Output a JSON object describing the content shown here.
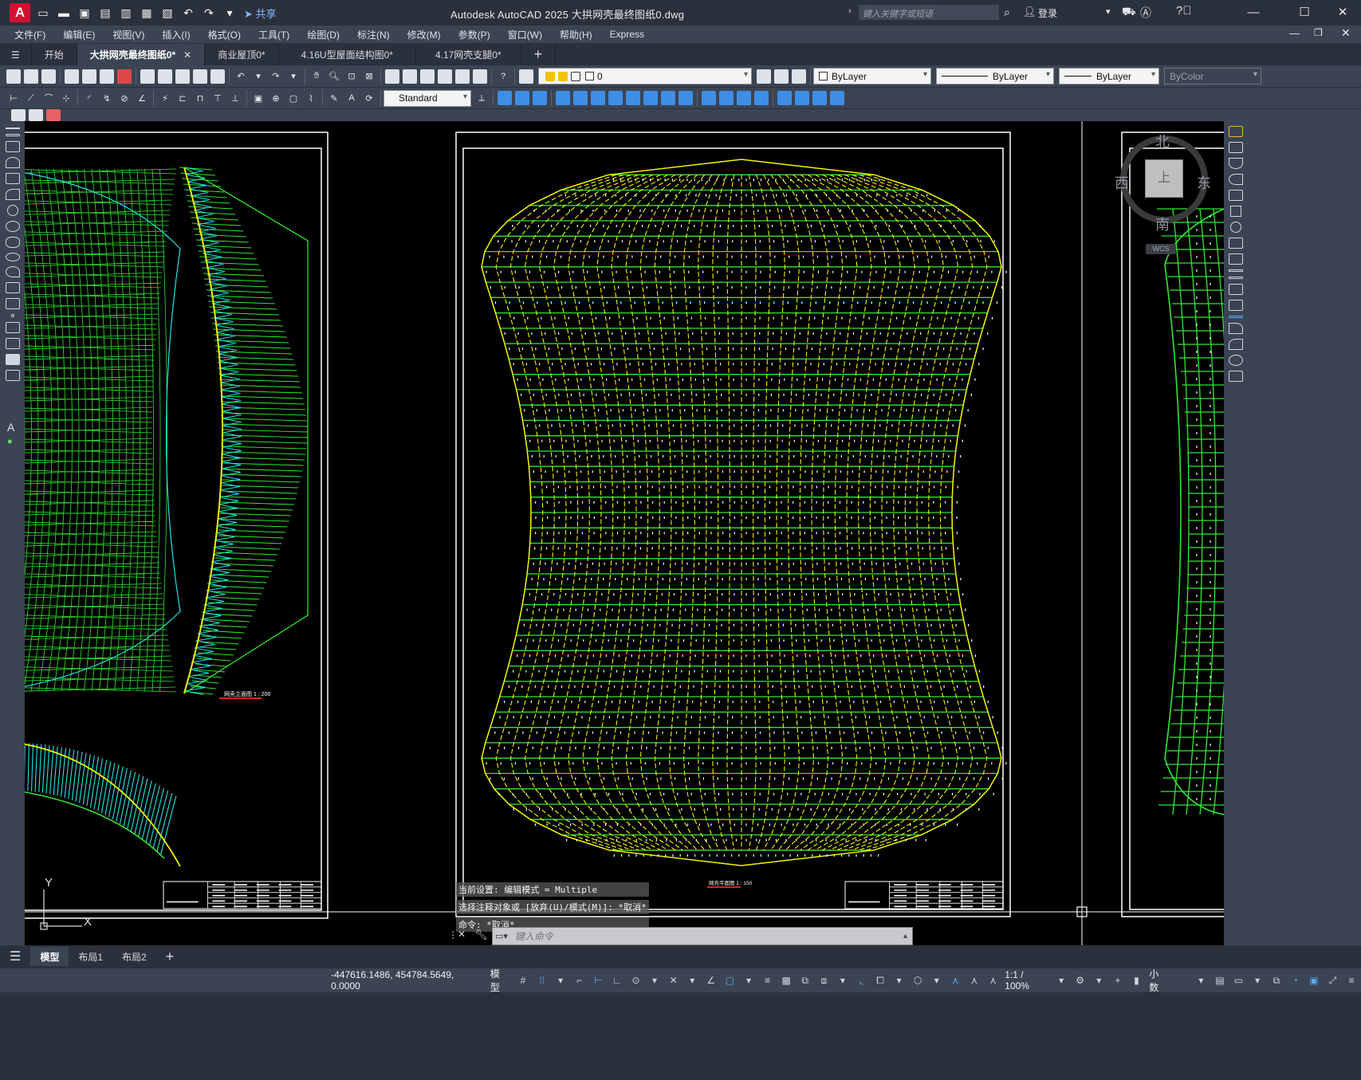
{
  "titlebar": {
    "app_letter": "A",
    "share": "共享",
    "title": "Autodesk AutoCAD 2025    大拱网壳最终图纸0.dwg",
    "search_placeholder": "键入关键字或短语",
    "login": "登录"
  },
  "menu": [
    "文件(F)",
    "编辑(E)",
    "视图(V)",
    "插入(I)",
    "格式(O)",
    "工具(T)",
    "绘图(D)",
    "标注(N)",
    "修改(M)",
    "参数(P)",
    "窗口(W)",
    "帮助(H)",
    "Express"
  ],
  "tabs": {
    "start": "开始",
    "items": [
      "大拱网壳最终图纸0*",
      "商业屋顶0*",
      "4.16U型屋面结构图0*",
      "4.17网壳支腿0*"
    ]
  },
  "properties": {
    "layer": "0",
    "color": "ByLayer",
    "linetype": "ByLayer",
    "lineweight": "ByLayer",
    "plotstyle": "ByColor",
    "dimstyle": "Standard"
  },
  "viewcube": {
    "north": "北",
    "south": "南",
    "east": "东",
    "west": "西",
    "top": "上",
    "wcs": "WCS"
  },
  "command": {
    "history": [
      "当前设置: 编辑模式 = Multiple",
      "选择注释对象或 [放弃(U)/模式(M)]: *取消*",
      "命令: *取消*"
    ],
    "placeholder": "键入命令"
  },
  "ucs": {
    "x": "X",
    "y": "Y"
  },
  "layout_tabs": [
    "模型",
    "布局1",
    "布局2"
  ],
  "status": {
    "coords": "-447616.1486, 454784.5649, 0.0000",
    "model": "模型",
    "scale": "1:1 / 100%",
    "units": "小数"
  },
  "drawing": {
    "label_left": "网壳立面图 1 : 200",
    "label_center": "网壳平面图 1 : 150",
    "colors": {
      "green": "#2fe82f",
      "yellow": "#f4f400",
      "cyan": "#1ee6e6",
      "frame": "#ffffff",
      "red": "#e02020"
    }
  }
}
